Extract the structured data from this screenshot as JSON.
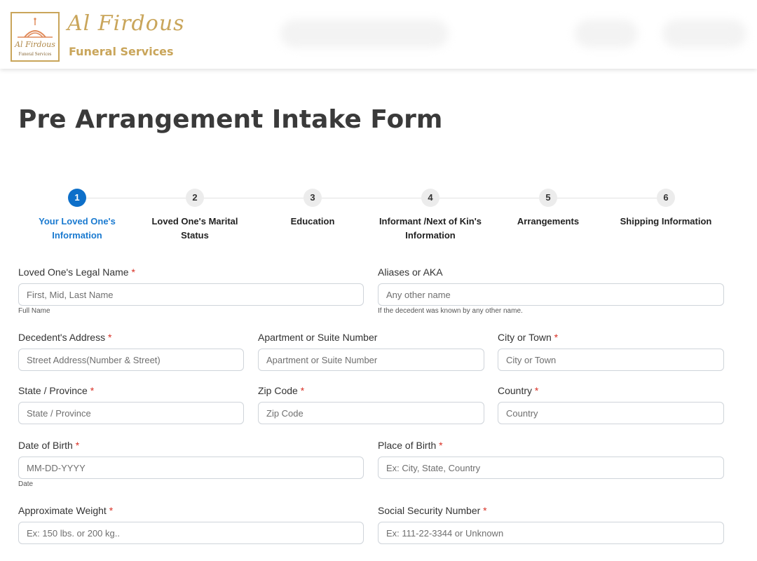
{
  "header": {
    "logo_box_name": "Al Firdous",
    "logo_box_sub": "Funeral Services",
    "brand_script": "Al Firdous",
    "brand_name": "Funeral Services",
    "logo_icon": "mosque-dome-logo"
  },
  "page_title": "Pre Arrangement Intake Form",
  "steps": [
    {
      "number": "1",
      "label_line1": "Your Loved One's",
      "label_line2": "Information",
      "active": true
    },
    {
      "number": "2",
      "label_line1": "Loved One's Marital",
      "label_line2": "Status",
      "active": false
    },
    {
      "number": "3",
      "label_line1": "Education",
      "label_line2": "",
      "active": false
    },
    {
      "number": "4",
      "label_line1": "Informant /Next of Kin's",
      "label_line2": "Information",
      "active": false
    },
    {
      "number": "5",
      "label_line1": "Arrangements",
      "label_line2": "",
      "active": false
    },
    {
      "number": "6",
      "label_line1": "Shipping Information",
      "label_line2": "",
      "active": false
    }
  ],
  "form": {
    "legal_name": {
      "label": "Loved One's Legal Name",
      "required": "*",
      "placeholder": "First, Mid, Last Name",
      "help": "Full Name"
    },
    "aliases": {
      "label": "Aliases or AKA",
      "placeholder": "Any other name",
      "help": "If the decedent was known by any other name."
    },
    "address": {
      "label": "Decedent's Address",
      "required": "*",
      "placeholder": "Street Address(Number & Street)"
    },
    "apartment": {
      "label": "Apartment or Suite Number",
      "placeholder": "Apartment or Suite Number"
    },
    "city": {
      "label": "City or Town",
      "required": "*",
      "placeholder": "City or Town"
    },
    "state": {
      "label": "State / Province",
      "required": "*",
      "placeholder": "State / Province"
    },
    "zip": {
      "label": "Zip Code",
      "required": "*",
      "placeholder": "Zip Code"
    },
    "country": {
      "label": "Country",
      "required": "*",
      "placeholder": "Country"
    },
    "dob": {
      "label": "Date of Birth",
      "required": "*",
      "placeholder": "MM-DD-YYYY",
      "help": "Date"
    },
    "pob": {
      "label": "Place of Birth",
      "required": "*",
      "placeholder": "Ex: City, State, Country"
    },
    "weight": {
      "label": "Approximate Weight",
      "required": "*",
      "placeholder": "Ex: 150 lbs. or 200 kg.."
    },
    "ssn": {
      "label": "Social Security Number",
      "required": "*",
      "placeholder": "Ex: 111-22-3344 or Unknown"
    }
  },
  "colors": {
    "accent": "#0d6fc9",
    "brand_gold": "#c9a55a",
    "required": "#d93025"
  }
}
